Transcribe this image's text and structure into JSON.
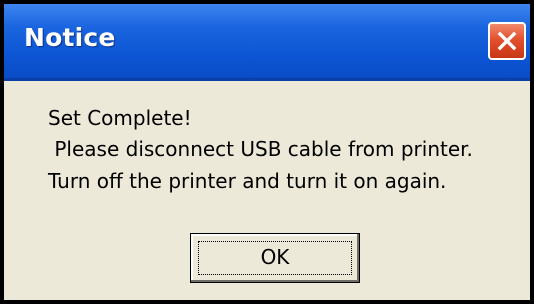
{
  "dialog": {
    "title": "Notice",
    "close_icon": "close-icon",
    "close_button_color": "#e2502d",
    "titlebar_color": "#0c55d4",
    "body_color": "#ece9d8",
    "message_lines": [
      "Set Complete!",
      " Please disconnect USB cable from printer.",
      "Turn off the printer and turn it on again."
    ],
    "ok_label": "OK"
  }
}
